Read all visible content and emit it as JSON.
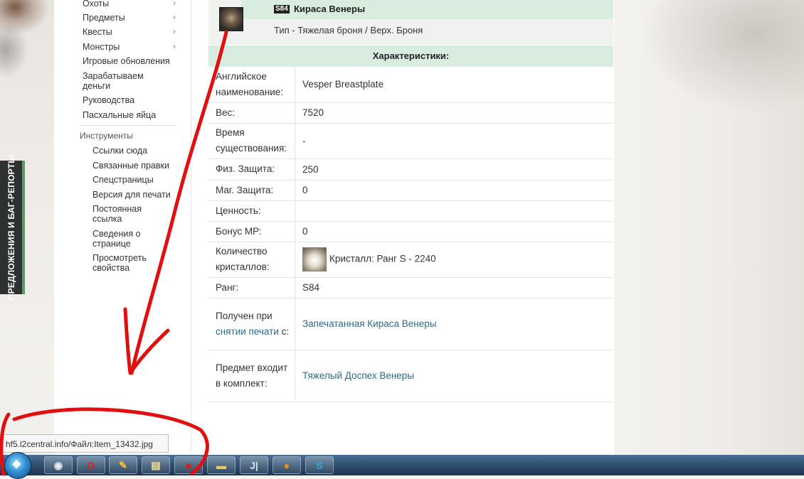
{
  "feedback_tab": {
    "label": "ПРЕДЛОЖЕНИЯ И БАГ-РЕПОРТЫ"
  },
  "sidebar": {
    "items": [
      {
        "label": "Охоты",
        "chevron": "›"
      },
      {
        "label": "Предметы",
        "chevron": "›"
      },
      {
        "label": "Квесты",
        "chevron": "›"
      },
      {
        "label": "Монстры",
        "chevron": "›"
      },
      {
        "label": "Игровые обновления"
      },
      {
        "label": "Зарабатываем деньги"
      },
      {
        "label": "Руководства"
      },
      {
        "label": "Пасхальные яйца"
      }
    ],
    "tools_heading": "Инструменты",
    "tools": [
      {
        "label": "Ссылки сюда"
      },
      {
        "label": "Связанные правки"
      },
      {
        "label": "Спецстраницы"
      },
      {
        "label": "Версия для печати"
      },
      {
        "label": "Постоянная ссылка"
      },
      {
        "label": "Сведения о странице"
      },
      {
        "label": "Просмотреть свойства"
      }
    ]
  },
  "item": {
    "grade_badge": "S84",
    "name": "Кираса Венеры",
    "type": "Тип - Тяжелая броня / Верх. Броня"
  },
  "characteristics_title": "Характеристики:",
  "properties": [
    {
      "key": "Английское наименование:",
      "value": "Vesper Breastplate"
    },
    {
      "key": "Вес:",
      "value": "7520"
    },
    {
      "key": "Время существования:",
      "value": "-"
    },
    {
      "key": "Физ. Защита:",
      "value": "250"
    },
    {
      "key": "Маг. Защита:",
      "value": "0"
    },
    {
      "key": "Ценность:",
      "value": ""
    },
    {
      "key": "Бонус МР:",
      "value": "0"
    },
    {
      "key": "Количество кристаллов:",
      "value": "Кристалл: Ранг S - 2240"
    },
    {
      "key": "Ранг:",
      "value": "S84"
    },
    {
      "key_prefix": "Получен при",
      "key_link": "снятии печати",
      "key_suffix": "с:",
      "value": "Запечатанная Кираса Венеры"
    },
    {
      "key": "Предмет входит в комплект:",
      "value": "Тяжелый Доспех Венеры"
    }
  ],
  "status_url": "hf5.l2central.info/Файл:Item_13432.jpg",
  "taskbar": {
    "start_icon": "windows-orb-icon",
    "buttons": [
      {
        "icon": "chrome-icon",
        "glyph": "◉",
        "color": "#e8eef5"
      },
      {
        "icon": "opera-icon",
        "glyph": "O",
        "color": "#e02020"
      },
      {
        "icon": "pencil-icon",
        "glyph": "✎",
        "color": "#f0c040"
      },
      {
        "icon": "notepad-icon",
        "glyph": "▤",
        "color": "#f5e6a0"
      },
      {
        "icon": "red-app-icon",
        "glyph": "■",
        "color": "#cc2222"
      },
      {
        "icon": "folder-icon",
        "glyph": "▬",
        "color": "#e8c66a"
      },
      {
        "icon": "text-app-icon",
        "glyph": "J|",
        "color": "#cfe3f5"
      },
      {
        "icon": "firefox-icon",
        "glyph": "●",
        "color": "#ff8a1e"
      },
      {
        "icon": "skype-icon",
        "glyph": "S",
        "color": "#2aa8e8"
      }
    ]
  },
  "colors": {
    "accent_green": "#d9ece0",
    "link": "#2d6a8a",
    "annotation_red": "#e01010"
  }
}
